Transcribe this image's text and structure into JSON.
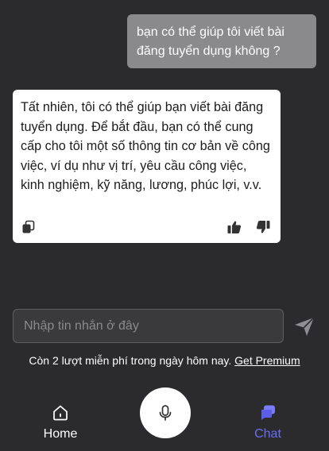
{
  "conversation": {
    "user_message": "bạn có thể giúp tôi viết bài đăng tuyển dụng không ?",
    "bot_message": "Tất nhiên, tôi có thể giúp bạn viết bài đăng tuyển dụng. Để bắt đầu, bạn có thể cung cấp cho tôi một số thông tin cơ bản về công việc, ví dụ như vị trí, yêu cầu công việc, kinh nghiệm, kỹ năng, lương, phúc lợi, v.v.",
    "actions": [
      "copy-icon",
      "thumbs-up-icon",
      "thumbs-down-icon"
    ]
  },
  "composer": {
    "placeholder": "Nhập tin nhắn ở đây",
    "value": "",
    "send_icon": "send-icon"
  },
  "quota": {
    "text": "Còn 2 lượt miễn phí trong ngày hôm nay.",
    "link": "Get Premium"
  },
  "nav": {
    "home_label": "Home",
    "chat_label": "Chat",
    "mic_icon": "microphone-icon",
    "active": "Chat",
    "active_color": "#6b6ef2"
  }
}
